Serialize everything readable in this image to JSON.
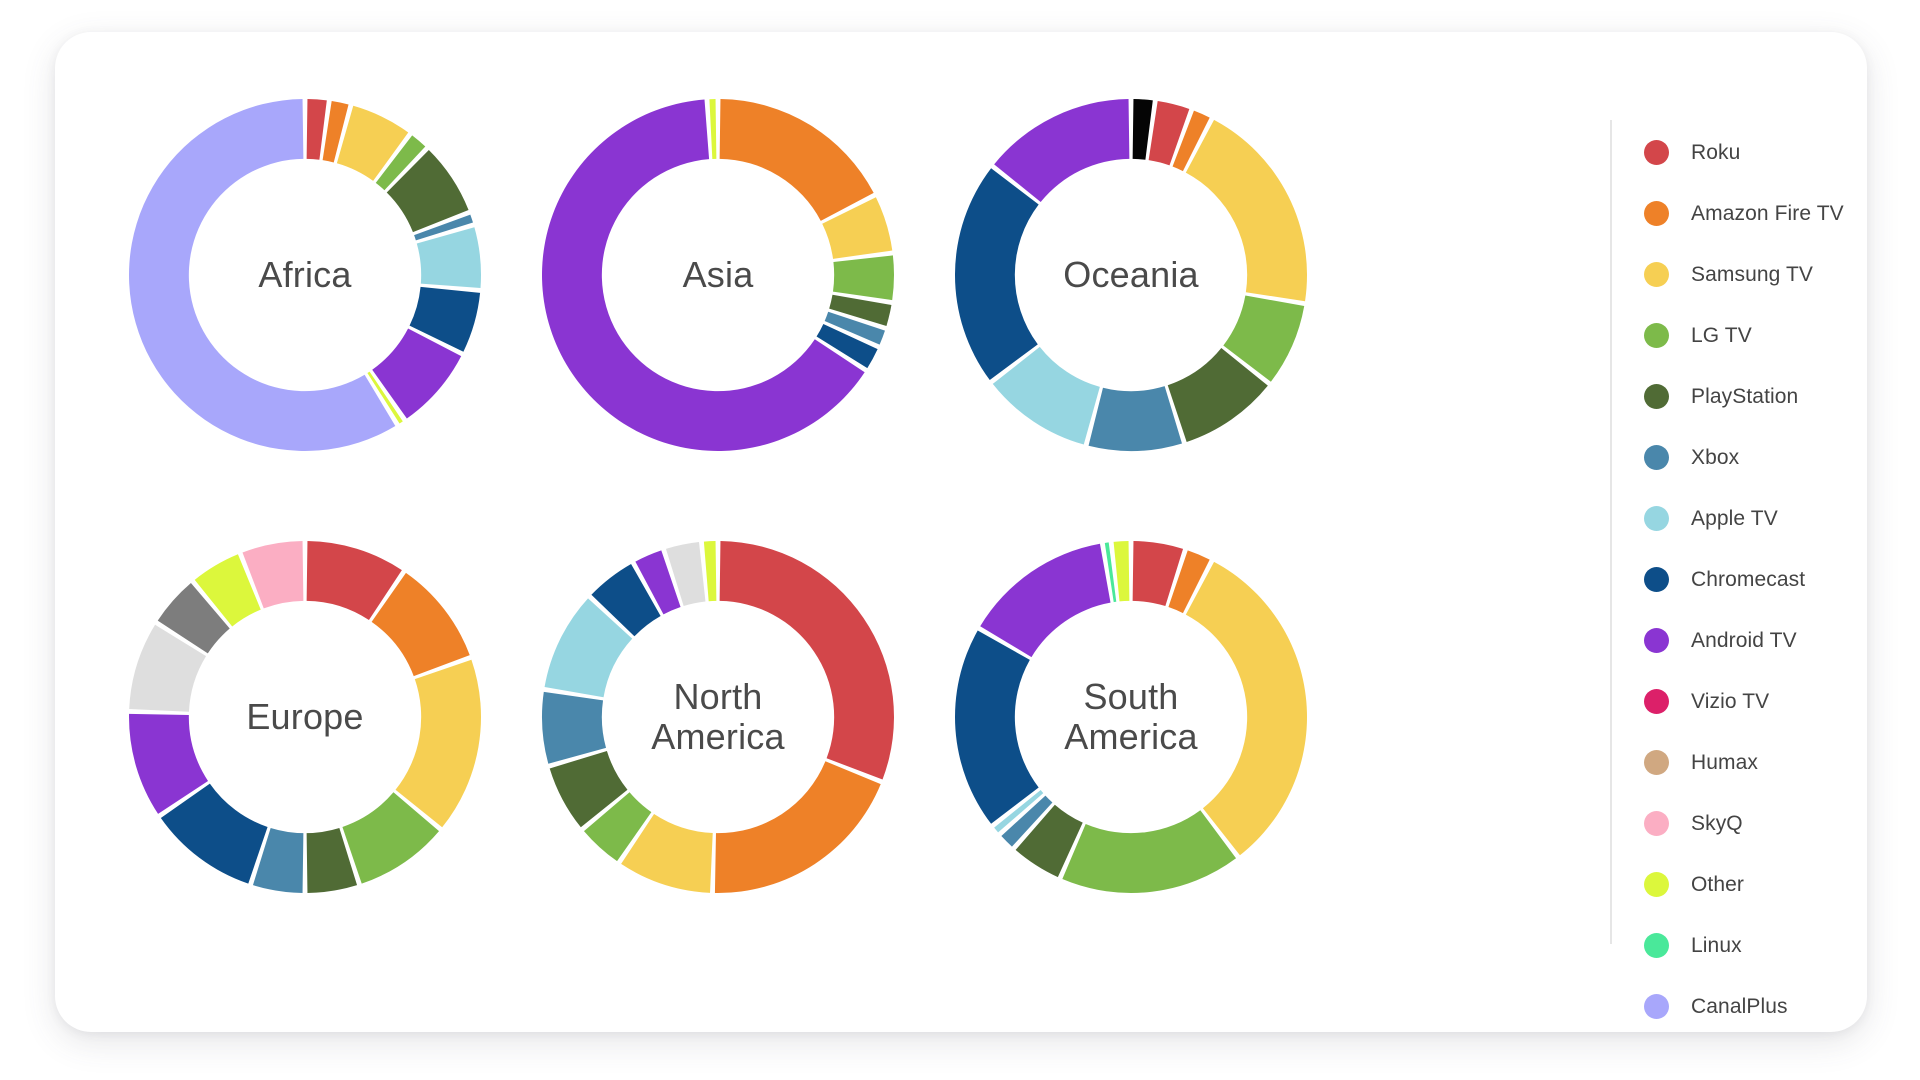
{
  "card": {
    "background": "#ffffff",
    "radius": 36
  },
  "legend": {
    "position": "right",
    "items": [
      {
        "label": "Roku",
        "color": "#d3464a"
      },
      {
        "label": "Amazon Fire TV",
        "color": "#ee8128"
      },
      {
        "label": "Samsung TV",
        "color": "#f6cf53"
      },
      {
        "label": "LG TV",
        "color": "#7dba4a"
      },
      {
        "label": "PlayStation",
        "color": "#506b35"
      },
      {
        "label": "Xbox",
        "color": "#4a87ab"
      },
      {
        "label": "Apple TV",
        "color": "#96d6e1"
      },
      {
        "label": "Chromecast",
        "color": "#0d4e89"
      },
      {
        "label": "Android TV",
        "color": "#8a35d2"
      },
      {
        "label": "Vizio TV",
        "color": "#dc2069"
      },
      {
        "label": "Humax",
        "color": "#d0a881"
      },
      {
        "label": "SkyQ",
        "color": "#fbaec3"
      },
      {
        "label": "Other",
        "color": "#dcf73c"
      },
      {
        "label": "Linux",
        "color": "#4ae89a"
      },
      {
        "label": "CanalPlus",
        "color": "#a8a7fb"
      }
    ]
  },
  "chart_data": {
    "type": "pie",
    "variant": "donut-small-multiples",
    "title": "",
    "legend_position": "right",
    "start_angle_deg": 0,
    "direction": "clockwise",
    "inner_radius_ratio": 0.66,
    "categories": [
      "Roku",
      "Amazon Fire TV",
      "Samsung TV",
      "LG TV",
      "PlayStation",
      "Xbox",
      "Apple TV",
      "Chromecast",
      "Android TV",
      "Vizio TV",
      "Humax",
      "SkyQ",
      "Other",
      "Linux",
      "CanalPlus"
    ],
    "colors": [
      "#d3464a",
      "#ee8128",
      "#f6cf53",
      "#7dba4a",
      "#506b35",
      "#4a87ab",
      "#96d6e1",
      "#0d4e89",
      "#8a35d2",
      "#dc2069",
      "#d0a881",
      "#fbaec3",
      "#dcf73c",
      "#4ae89a",
      "#a8a7fb"
    ],
    "charts": [
      {
        "name": "Africa",
        "label": "Africa",
        "grid": {
          "row": 0,
          "col": 0
        },
        "slices": [
          {
            "category": "Roku",
            "color": "#d3464a",
            "value": 2.2
          },
          {
            "category": "Amazon Fire TV",
            "color": "#ee8128",
            "value": 2.0
          },
          {
            "category": "Samsung TV",
            "color": "#f6cf53",
            "value": 6.0
          },
          {
            "category": "LG TV",
            "color": "#7dba4a",
            "value": 2.0
          },
          {
            "category": "PlayStation",
            "color": "#506b35",
            "value": 7.0
          },
          {
            "category": "Xbox",
            "color": "#4a87ab",
            "value": 1.2
          },
          {
            "category": "Apple TV",
            "color": "#96d6e1",
            "value": 6.0
          },
          {
            "category": "Chromecast",
            "color": "#0d4e89",
            "value": 6.0
          },
          {
            "category": "Android TV",
            "color": "#8a35d2",
            "value": 8.0
          },
          {
            "category": "Other",
            "color": "#dcf73c",
            "value": 0.8
          },
          {
            "category": "CanalPlus",
            "color": "#a8a7fb",
            "value": 58.8
          }
        ]
      },
      {
        "name": "Asia",
        "label": "Asia",
        "grid": {
          "row": 0,
          "col": 1
        },
        "slices": [
          {
            "category": "Amazon Fire TV",
            "color": "#ee8128",
            "value": 17.5
          },
          {
            "category": "Samsung TV",
            "color": "#f6cf53",
            "value": 5.5
          },
          {
            "category": "LG TV",
            "color": "#7dba4a",
            "value": 4.5
          },
          {
            "category": "PlayStation",
            "color": "#506b35",
            "value": 2.4
          },
          {
            "category": "Xbox",
            "color": "#4a87ab",
            "value": 1.8
          },
          {
            "category": "Chromecast",
            "color": "#0d4e89",
            "value": 2.4
          },
          {
            "category": "Android TV",
            "color": "#8a35d2",
            "value": 64.9
          },
          {
            "category": "Other",
            "color": "#dcf73c",
            "value": 1.0
          }
        ]
      },
      {
        "name": "Oceania",
        "label": "Oceania",
        "grid": {
          "row": 0,
          "col": 2
        },
        "slices": [
          {
            "category": "Unlabeled",
            "color": "#050505",
            "value": 2.2
          },
          {
            "category": "Roku",
            "color": "#d3464a",
            "value": 3.4
          },
          {
            "category": "Amazon Fire TV",
            "color": "#ee8128",
            "value": 2.0
          },
          {
            "category": "Samsung TV",
            "color": "#f6cf53",
            "value": 20.0
          },
          {
            "category": "LG TV",
            "color": "#7dba4a",
            "value": 8.0
          },
          {
            "category": "PlayStation",
            "color": "#506b35",
            "value": 9.5
          },
          {
            "category": "Xbox",
            "color": "#4a87ab",
            "value": 9.0
          },
          {
            "category": "Apple TV",
            "color": "#96d6e1",
            "value": 10.5
          },
          {
            "category": "Chromecast",
            "color": "#0d4e89",
            "value": 21.0
          },
          {
            "category": "Android TV",
            "color": "#8a35d2",
            "value": 14.4
          }
        ]
      },
      {
        "name": "Europe",
        "label": "Europe",
        "grid": {
          "row": 1,
          "col": 0
        },
        "slices": [
          {
            "category": "Roku",
            "color": "#d3464a",
            "value": 9.5
          },
          {
            "category": "Amazon Fire TV",
            "color": "#ee8128",
            "value": 10.0
          },
          {
            "category": "Samsung TV",
            "color": "#f6cf53",
            "value": 16.5
          },
          {
            "category": "LG TV",
            "color": "#7dba4a",
            "value": 9.0
          },
          {
            "category": "PlayStation",
            "color": "#506b35",
            "value": 5.0
          },
          {
            "category": "Xbox",
            "color": "#4a87ab",
            "value": 5.0
          },
          {
            "category": "Chromecast",
            "color": "#0d4e89",
            "value": 10.5
          },
          {
            "category": "Android TV",
            "color": "#8a35d2",
            "value": 10.0
          },
          {
            "category": "Humax",
            "color": "#dedede",
            "value": 8.5
          },
          {
            "category": "Unlabeled",
            "color": "#7d7d7d",
            "value": 5.0
          },
          {
            "category": "Other",
            "color": "#dcf73c",
            "value": 5.0
          },
          {
            "category": "SkyQ",
            "color": "#fbaec3",
            "value": 6.0
          }
        ]
      },
      {
        "name": "North America",
        "label": "North\nAmerica",
        "grid": {
          "row": 1,
          "col": 1
        },
        "slices": [
          {
            "category": "Roku",
            "color": "#d3464a",
            "value": 31.0
          },
          {
            "category": "Amazon Fire TV",
            "color": "#ee8128",
            "value": 19.5
          },
          {
            "category": "Samsung TV",
            "color": "#f6cf53",
            "value": 9.0
          },
          {
            "category": "LG TV",
            "color": "#7dba4a",
            "value": 4.5
          },
          {
            "category": "PlayStation",
            "color": "#506b35",
            "value": 6.5
          },
          {
            "category": "Xbox",
            "color": "#4a87ab",
            "value": 7.0
          },
          {
            "category": "Apple TV",
            "color": "#96d6e1",
            "value": 9.5
          },
          {
            "category": "Chromecast",
            "color": "#0d4e89",
            "value": 5.0
          },
          {
            "category": "Android TV",
            "color": "#8a35d2",
            "value": 3.0
          },
          {
            "category": "Humax",
            "color": "#dedede",
            "value": 3.5
          },
          {
            "category": "Other",
            "color": "#dcf73c",
            "value": 1.5
          }
        ]
      },
      {
        "name": "South America",
        "label": "South\nAmerica",
        "grid": {
          "row": 1,
          "col": 2
        },
        "slices": [
          {
            "category": "Roku",
            "color": "#d3464a",
            "value": 5.0
          },
          {
            "category": "Amazon Fire TV",
            "color": "#ee8128",
            "value": 2.6
          },
          {
            "category": "Samsung TV",
            "color": "#f6cf53",
            "value": 32.0
          },
          {
            "category": "LG TV",
            "color": "#7dba4a",
            "value": 17.0
          },
          {
            "category": "PlayStation",
            "color": "#506b35",
            "value": 5.0
          },
          {
            "category": "Xbox",
            "color": "#4a87ab",
            "value": 1.8
          },
          {
            "category": "Apple TV",
            "color": "#96d6e1",
            "value": 1.0
          },
          {
            "category": "Chromecast",
            "color": "#0d4e89",
            "value": 19.0
          },
          {
            "category": "Android TV",
            "color": "#8a35d2",
            "value": 14.0
          },
          {
            "category": "Linux",
            "color": "#4ae89a",
            "value": 0.8
          },
          {
            "category": "Other",
            "color": "#dcf73c",
            "value": 1.8
          }
        ]
      }
    ]
  }
}
